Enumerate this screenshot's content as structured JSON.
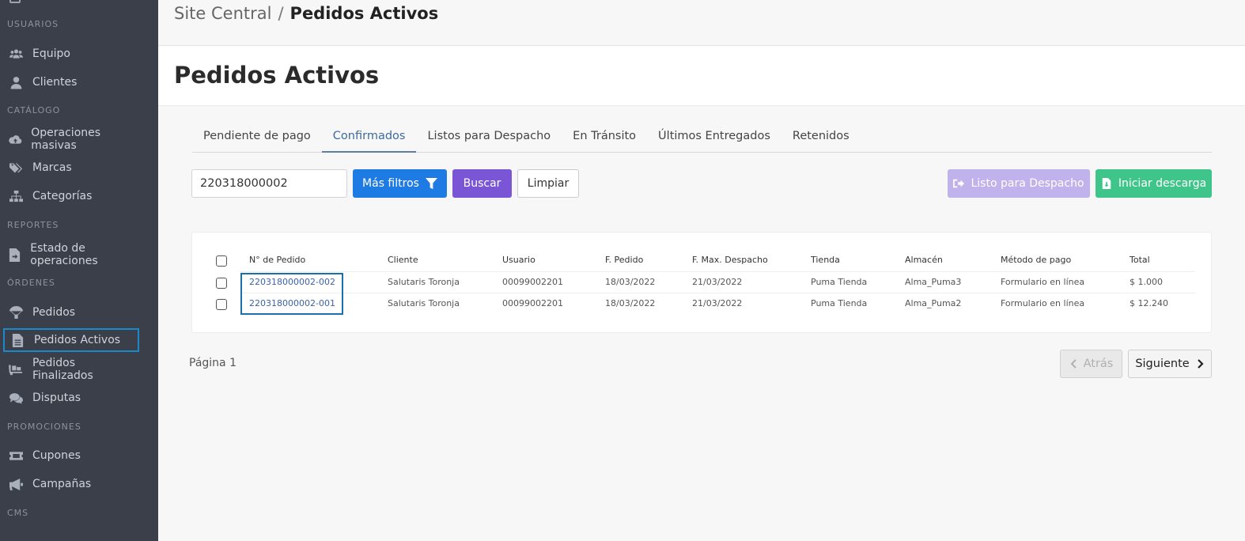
{
  "breadcrumb": {
    "root": "Site Central",
    "separator": "/",
    "current": "Pedidos Activos"
  },
  "page": {
    "title": "Pedidos Activos"
  },
  "sidebar": {
    "sections": [
      {
        "label": "USUARIOS"
      },
      {
        "label": "CATÁLOGO"
      },
      {
        "label": "REPORTES"
      },
      {
        "label": "ÓRDENES"
      },
      {
        "label": "PROMOCIONES"
      },
      {
        "label": "CMS"
      }
    ],
    "items": [
      {
        "label": "Equipo",
        "icon": "users-icon"
      },
      {
        "label": "Clientes",
        "icon": "user-icon"
      },
      {
        "label": "Operaciones masivas",
        "icon": "cloud-upload-icon"
      },
      {
        "label": "Marcas",
        "icon": "tags-icon"
      },
      {
        "label": "Categorías",
        "icon": "sitemap-icon"
      },
      {
        "label": "Estado de operaciones",
        "icon": "file-export-icon"
      },
      {
        "label": "Pedidos",
        "icon": "parachute-box-icon"
      },
      {
        "label": "Pedidos Activos",
        "icon": "file-list-icon",
        "active": true
      },
      {
        "label": "Pedidos Finalizados",
        "icon": "dolly-icon"
      },
      {
        "label": "Disputas",
        "icon": "comments-icon"
      },
      {
        "label": "Cupones",
        "icon": "ticket-icon"
      },
      {
        "label": "Campañas",
        "icon": "bullhorn-icon"
      }
    ]
  },
  "tabs": [
    {
      "label": "Pendiente de pago"
    },
    {
      "label": "Confirmados",
      "active": true
    },
    {
      "label": "Listos para Despacho"
    },
    {
      "label": "En Tránsito"
    },
    {
      "label": "Últimos Entregados"
    },
    {
      "label": "Retenidos"
    }
  ],
  "filters": {
    "search_value": "220318000002",
    "more_filters_label": "Más filtros",
    "search_label": "Buscar",
    "clear_label": "Limpiar",
    "ready_label": "Listo para Despacho",
    "download_label": "Iniciar descarga"
  },
  "table": {
    "headers": [
      "N° de Pedido",
      "Cliente",
      "Usuario",
      "F. Pedido",
      "F. Max. Despacho",
      "Tienda",
      "Almacén",
      "Método de pago",
      "Total"
    ],
    "rows": [
      {
        "order": "220318000002-002",
        "client": "Salutaris Toronja",
        "user": "00099002201",
        "date": "18/03/2022",
        "max_date": "21/03/2022",
        "store": "Puma Tienda",
        "warehouse": "Alma_Puma3",
        "payment": "Formulario en línea",
        "total": "$ 1.000"
      },
      {
        "order": "220318000002-001",
        "client": "Salutaris Toronja",
        "user": "00099002201",
        "date": "18/03/2022",
        "max_date": "21/03/2022",
        "store": "Puma Tienda",
        "warehouse": "Alma_Puma2",
        "payment": "Formulario en línea",
        "total": "$ 12.240"
      }
    ]
  },
  "pagination": {
    "page_label": "Página 1",
    "prev_label": "Atrás",
    "next_label": "Siguiente"
  },
  "colors": {
    "sidebar_bg": "#3b3f4a",
    "primary": "#1e7be3",
    "purple": "#7a55d6",
    "green": "#3fc58a",
    "highlight": "#1a6fae"
  }
}
